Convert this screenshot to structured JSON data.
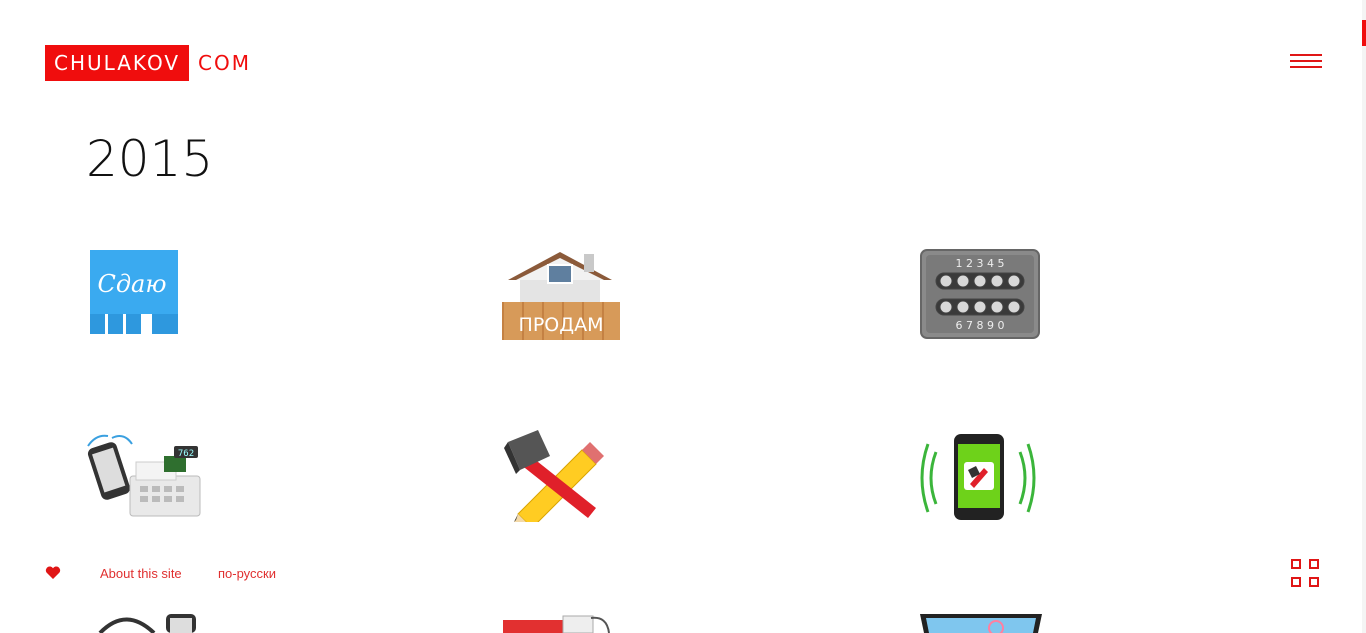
{
  "header": {
    "logo_box": "CHULAKOV",
    "logo_rest": "COM"
  },
  "main": {
    "year": "2015"
  },
  "tiles": [
    {
      "id": "sdayu",
      "label": "Сдаю"
    },
    {
      "id": "prodam",
      "label": "ПРОДАМ"
    },
    {
      "id": "code-lock",
      "top_digits": "1 2 3 4 5",
      "bottom_digits": "6 7 8 9 0"
    },
    {
      "id": "pos",
      "price": "762"
    },
    {
      "id": "tools"
    },
    {
      "id": "phone-signal"
    }
  ],
  "footer": {
    "about": "About this site",
    "russian": "по-русски"
  },
  "colors": {
    "accent": "#f00d0d"
  }
}
